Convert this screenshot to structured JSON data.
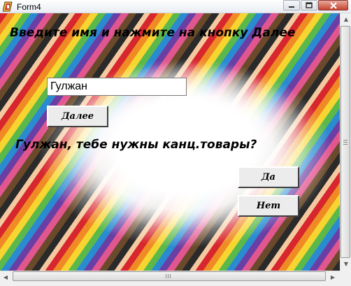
{
  "window": {
    "title": "Form4",
    "icon": "delphi-app-icon"
  },
  "titlebar": {
    "minimize_icon": "minimize-icon",
    "maximize_icon": "maximize-icon",
    "close_icon": "close-icon"
  },
  "form": {
    "prompt": "Введите имя и нажмите на кнопку Далее",
    "name_value": "Гулжан",
    "next_button": "Далее",
    "question": "Гулжан, тебе нужны канц.товары?",
    "yes_button": "Да",
    "no_button": "Нет",
    "background": "colored-pencils-image"
  },
  "scrollbars": {
    "up_arrow": "▲",
    "down_arrow": "▼",
    "left_arrow": "◀",
    "right_arrow": "▶"
  },
  "colors": {
    "titlebar_top": "#ffffff",
    "close_button": "#c4442f",
    "button_face": "#ececec"
  }
}
